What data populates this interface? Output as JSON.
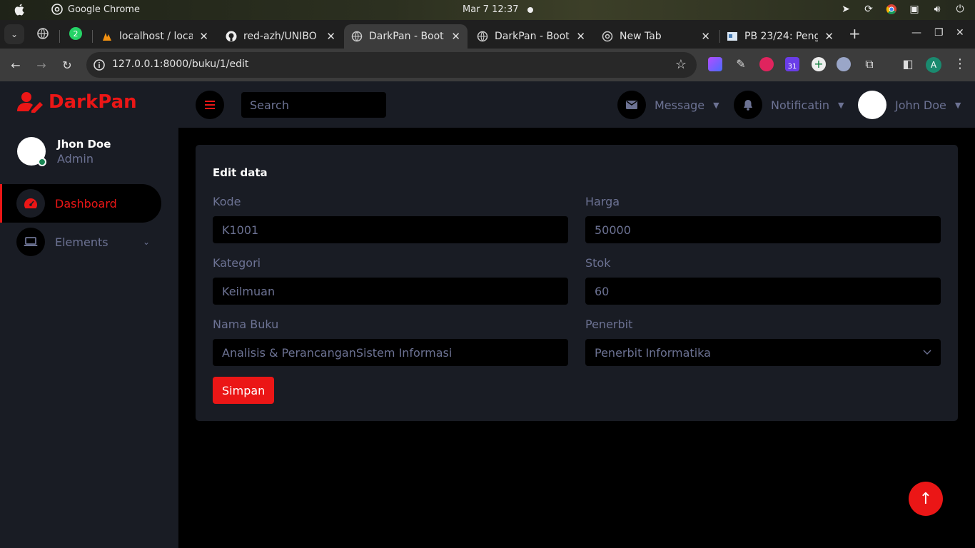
{
  "os": {
    "app_name": "Google Chrome",
    "clock": "Mar 7  12:37"
  },
  "browser": {
    "tabs": [
      {
        "title": "localhost / loca",
        "active": false
      },
      {
        "title": "red-azh/UNIBO",
        "active": false
      },
      {
        "title": "DarkPan - Boot",
        "active": true
      },
      {
        "title": "DarkPan - Boot",
        "active": false
      },
      {
        "title": "New Tab",
        "active": false
      },
      {
        "title": "PB 23/24: Peng",
        "active": false
      }
    ],
    "pinned_badge": "2",
    "url": "127.0.0.1:8000/buku/1/edit",
    "calendar_badge": "31",
    "profile_initial": "A"
  },
  "app": {
    "brand": "DarkPan",
    "accent_color": "#eb1616",
    "profile": {
      "name": "Jhon Doe",
      "role": "Admin"
    },
    "sidebar": {
      "items": [
        {
          "label": "Dashboard",
          "icon": "tachometer-icon",
          "active": true
        },
        {
          "label": "Elements",
          "icon": "laptop-icon",
          "active": false
        }
      ]
    },
    "topnav": {
      "search_placeholder": "Search",
      "message_label": "Message",
      "notification_label": "Notificatin",
      "user_label": "John Doe"
    },
    "form": {
      "title": "Edit data",
      "fields": {
        "kode": {
          "label": "Kode",
          "value": "K1001"
        },
        "harga": {
          "label": "Harga",
          "value": "50000"
        },
        "kategori": {
          "label": "Kategori",
          "value": "Keilmuan"
        },
        "stok": {
          "label": "Stok",
          "value": "60"
        },
        "nama_buku": {
          "label": "Nama Buku",
          "value": "Analisis & PerancanganSistem Informasi"
        },
        "penerbit": {
          "label": "Penerbit",
          "value": "Penerbit Informatika"
        }
      },
      "submit_label": "Simpan"
    }
  }
}
